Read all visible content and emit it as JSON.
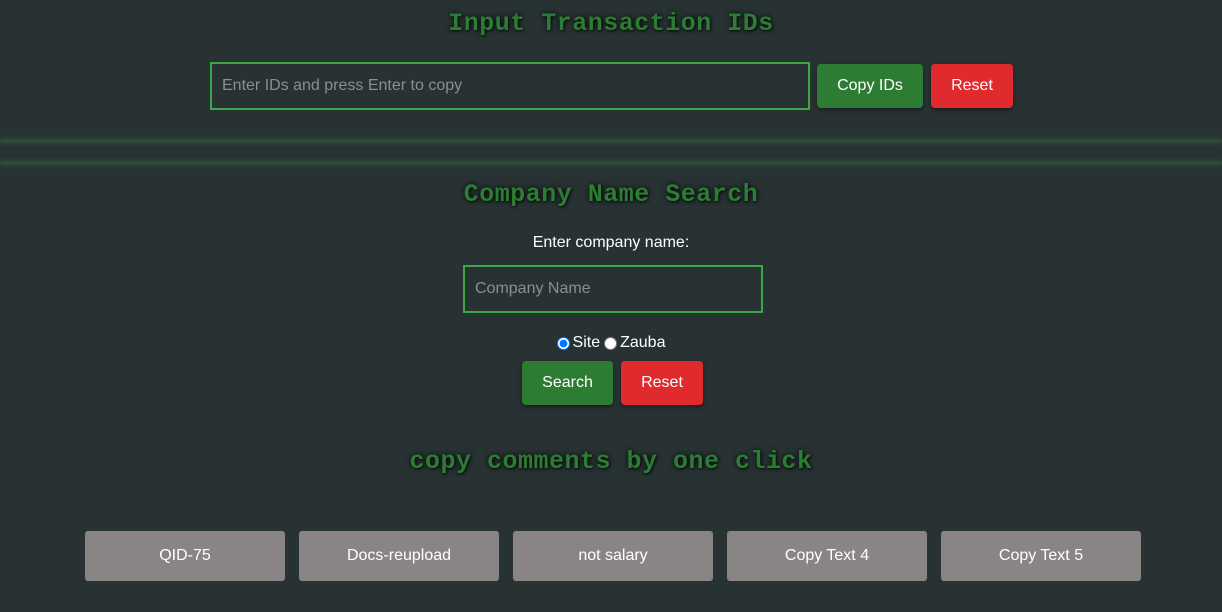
{
  "transaction_ids": {
    "title": "Input Transaction IDs",
    "input_placeholder": "Enter IDs and press Enter to copy",
    "input_value": "",
    "copy_label": "Copy IDs",
    "reset_label": "Reset"
  },
  "company_search": {
    "title": "Company Name Search",
    "prompt": "Enter company name:",
    "input_placeholder": "Company Name",
    "input_value": "",
    "radio_options": [
      {
        "label": "Site",
        "checked": true
      },
      {
        "label": "Zauba",
        "checked": false
      }
    ],
    "search_label": "Search",
    "reset_label": "Reset"
  },
  "comments": {
    "title": "copy comments by one click",
    "buttons": [
      "QID-75",
      "Docs-reupload",
      "not salary",
      "Copy Text 4",
      "Copy Text 5"
    ]
  },
  "colors": {
    "background": "#283233",
    "heading_green": "#2c7d33",
    "input_border": "#3fa645",
    "primary_button": "#2c7d33",
    "danger_button": "#e02a2e",
    "comment_button": "#898585"
  }
}
